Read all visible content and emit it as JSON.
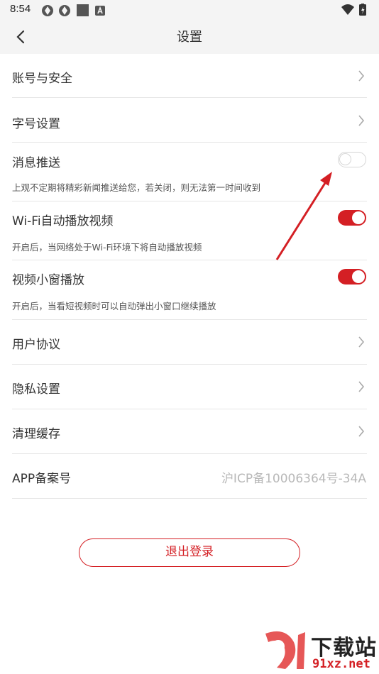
{
  "status_bar": {
    "time": "8:54"
  },
  "header": {
    "title": "设置"
  },
  "settings": {
    "account_security": "账号与安全",
    "font_size": "字号设置",
    "push": {
      "label": "消息推送",
      "desc": "上观不定期将精彩新闻推送给您，若关闭，则无法第一时间收到",
      "enabled": false
    },
    "wifi_autoplay": {
      "label": "Wi-Fi自动播放视频",
      "desc": "开启后，当网络处于Wi-Fi环境下将自动播放视频",
      "enabled": true
    },
    "mini_window": {
      "label": "视频小窗播放",
      "desc": "开启后，当看短视频时可以自动弹出小窗口继续播放",
      "enabled": true
    },
    "user_agreement": "用户协议",
    "privacy": "隐私设置",
    "clear_cache": "清理缓存",
    "icp": {
      "label": "APP备案号",
      "value": "沪ICP备10006364号-34A"
    }
  },
  "logout": {
    "label": "退出登录"
  },
  "watermark": {
    "brand": "下载站",
    "site": "91xz.net"
  },
  "colors": {
    "accent": "#d41f24",
    "header_bg": "#f4f4f4"
  }
}
